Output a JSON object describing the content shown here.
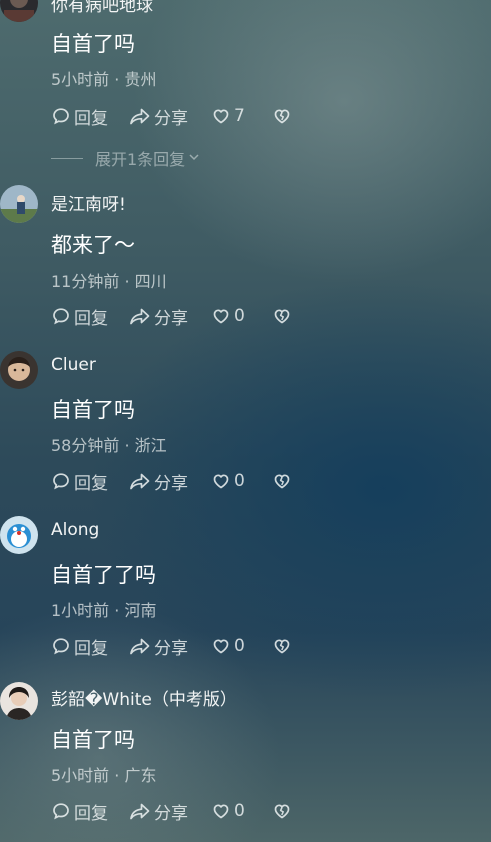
{
  "actions": {
    "reply_label": "回复",
    "share_label": "分享"
  },
  "comments": [
    {
      "username": "你有病吧地球",
      "content": "自首了吗",
      "meta": "5小时前 · 贵州",
      "likes": "7",
      "replies_toggle": "展开1条回复"
    },
    {
      "username": "是江南呀!",
      "content": "都来了～",
      "meta": "11分钟前 · 四川",
      "likes": "0"
    },
    {
      "username": "Cluer",
      "content": "自首了吗",
      "meta": "58分钟前 · 浙江",
      "likes": "0"
    },
    {
      "username": "Along",
      "content": "自首了了吗",
      "meta": "1小时前 · 河南",
      "likes": "0"
    },
    {
      "username": "彭韶�White（中考版）",
      "content": "自首了吗",
      "meta": "5小时前 · 广东",
      "likes": "0"
    }
  ]
}
